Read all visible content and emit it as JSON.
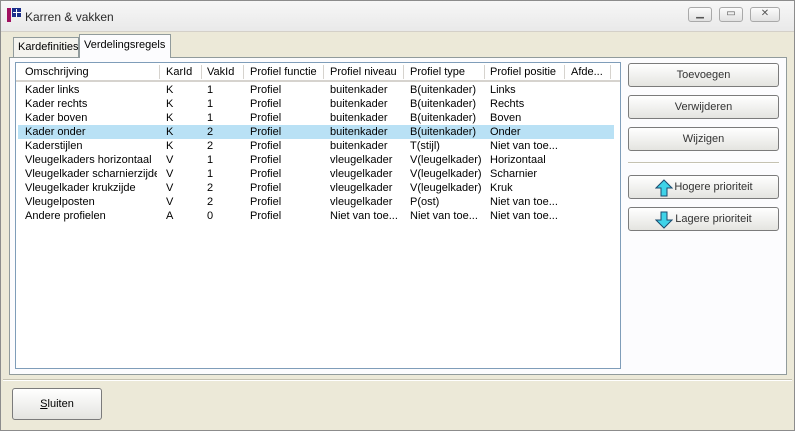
{
  "window": {
    "title": "Karren & vakken"
  },
  "tabs": [
    {
      "label": "Kardefinities"
    },
    {
      "label": "Verdelingsregels"
    }
  ],
  "table": {
    "columns": [
      "Omschrijving",
      "KarId",
      "VakId",
      "Profiel functie",
      "Profiel niveau",
      "Profiel type",
      "Profiel positie",
      "Afde..."
    ],
    "rows": [
      [
        "Kader links",
        "K",
        "1",
        "Profiel",
        "buitenkader",
        "B(uitenkader)",
        "Links",
        ""
      ],
      [
        "Kader rechts",
        "K",
        "1",
        "Profiel",
        "buitenkader",
        "B(uitenkader)",
        "Rechts",
        ""
      ],
      [
        "Kader boven",
        "K",
        "1",
        "Profiel",
        "buitenkader",
        "B(uitenkader)",
        "Boven",
        ""
      ],
      [
        "Kader onder",
        "K",
        "2",
        "Profiel",
        "buitenkader",
        "B(uitenkader)",
        "Onder",
        ""
      ],
      [
        "Kaderstijlen",
        "K",
        "2",
        "Profiel",
        "buitenkader",
        "T(stijl)",
        "Niet van toe...",
        ""
      ],
      [
        "Vleugelkaders horizontaal",
        "V",
        "1",
        "Profiel",
        "vleugelkader",
        "V(leugelkader)",
        "Horizontaal",
        ""
      ],
      [
        "Vleugelkader scharnierzijde",
        "V",
        "1",
        "Profiel",
        "vleugelkader",
        "V(leugelkader)",
        "Scharnier",
        ""
      ],
      [
        "Vleugelkader krukzijde",
        "V",
        "2",
        "Profiel",
        "vleugelkader",
        "V(leugelkader)",
        "Kruk",
        ""
      ],
      [
        "Vleugelposten",
        "V",
        "2",
        "Profiel",
        "vleugelkader",
        "P(ost)",
        "Niet van toe...",
        ""
      ],
      [
        "Andere profielen",
        "A",
        "0",
        "Profiel",
        "Niet van toe...",
        "Niet van toe...",
        "Niet van toe...",
        ""
      ]
    ],
    "selected_row": "Kader onder"
  },
  "buttons": {
    "add": "Toevoegen",
    "remove": "Verwijderen",
    "edit": "Wijzigen",
    "up": "Hogere prioriteit",
    "down": "Lagere prioriteit",
    "close_underlined": "S",
    "close_rest": "luiten"
  },
  "colors": {
    "selection": "#b9e1f5",
    "arrow": "#3fd3e8"
  }
}
